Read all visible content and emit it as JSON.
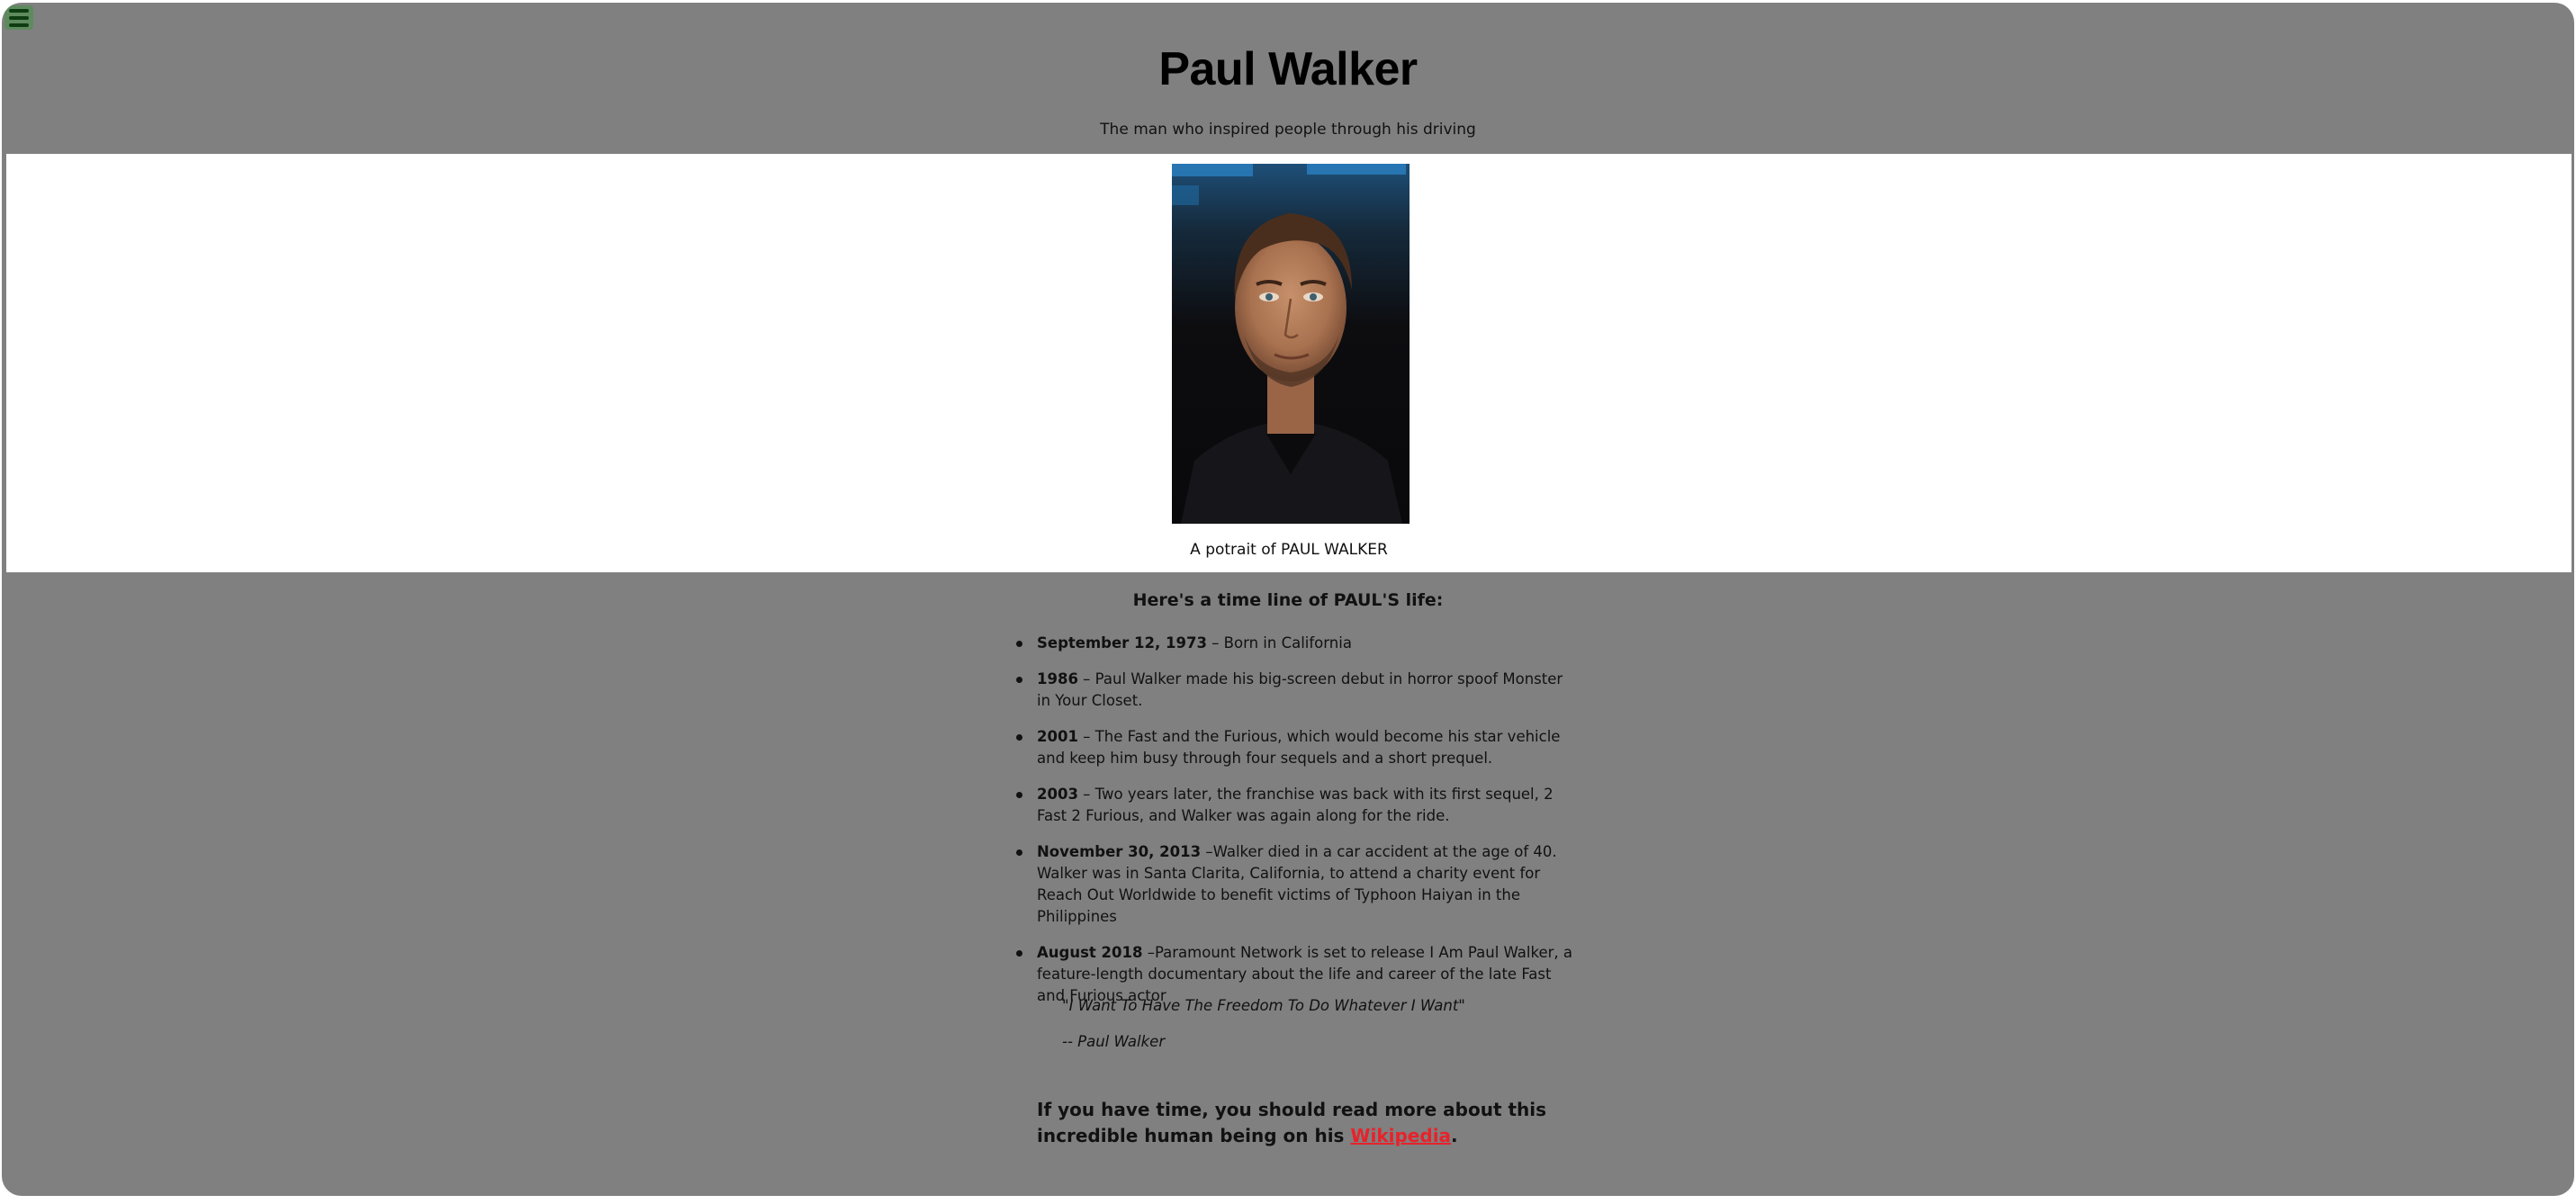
{
  "header": {
    "title": "Paul Walker",
    "tagline": "The man who inspired people through his driving"
  },
  "figure": {
    "caption": "A potrait of PAUL WALKER"
  },
  "timeline": {
    "heading": "Here's a time line of PAUL'S life:",
    "items": [
      {
        "date": "September 12, 1973",
        "text": " – Born in California"
      },
      {
        "date": "1986",
        "text": " – Paul Walker made his big-screen debut in horror spoof Monster in Your Closet."
      },
      {
        "date": "2001",
        "text": " – The Fast and the Furious, which would become his star vehicle and keep him busy through four sequels and a short prequel."
      },
      {
        "date": "2003",
        "text": " – Two years later, the franchise was back with its first sequel, 2 Fast 2 Furious, and Walker was again along for the ride."
      },
      {
        "date": "November 30, 2013",
        "text": " –Walker died in a car accident at the age of 40. Walker was in Santa Clarita, California, to attend a charity event for Reach Out Worldwide to benefit victims of Typhoon Haiyan in the Philippines"
      },
      {
        "date": "August 2018",
        "text": " –Paramount Network is set to release I Am Paul Walker, a feature-length documentary about the life and career of the late Fast and Furious actor"
      }
    ]
  },
  "quote": {
    "text": "\"I Want To Have The Freedom To Do Whatever I Want\"",
    "attribution": "-- Paul Walker"
  },
  "more_info": {
    "before": "If you have time, you should read more about this incredible human being on his ",
    "link_label": "Wikipedia",
    "after": "."
  },
  "icons": {
    "menu": "hamburger-menu-icon"
  },
  "colors": {
    "page_background": "#808080",
    "figure_band": "#ffffff",
    "link": "#e8222a",
    "menu_button": "#5e8a5e"
  }
}
